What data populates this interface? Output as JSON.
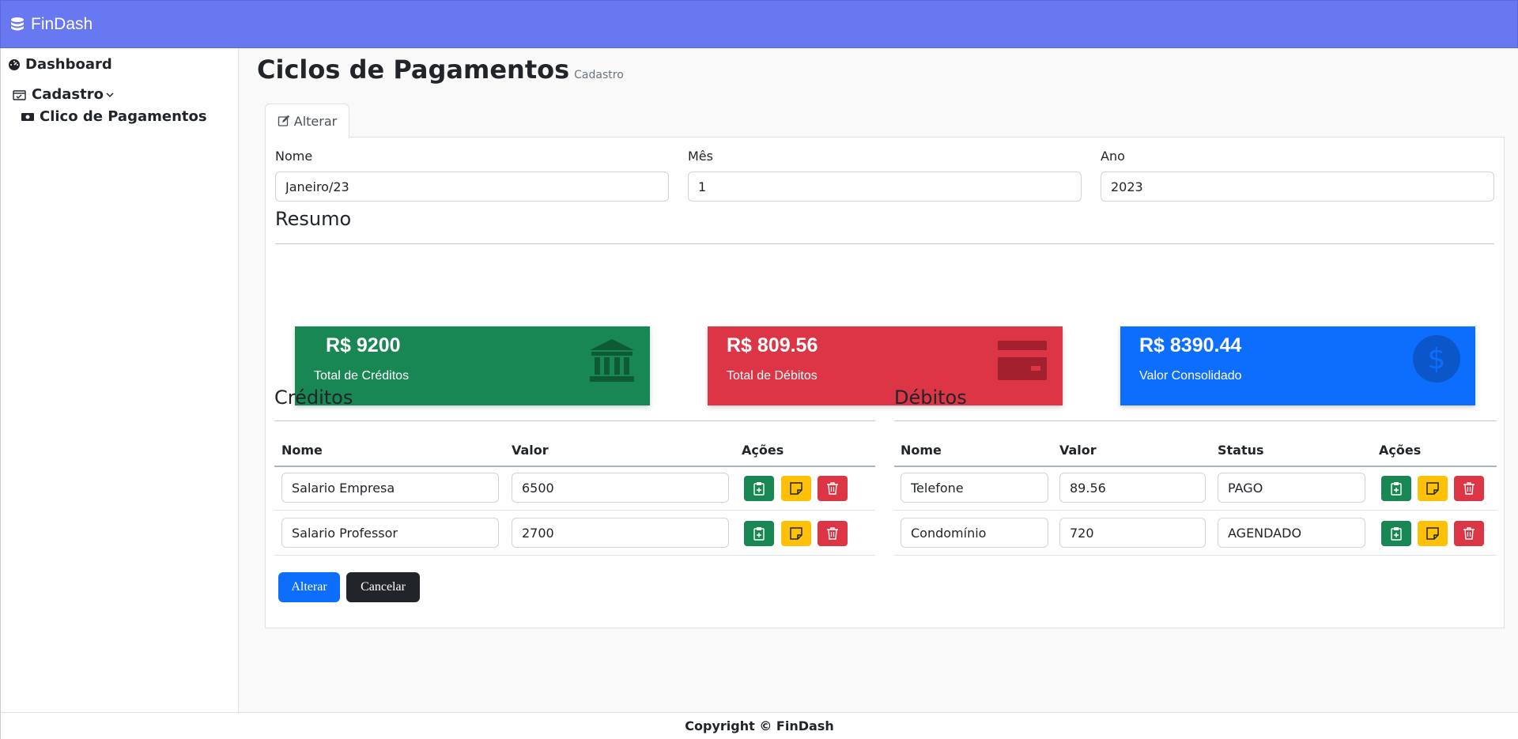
{
  "app": {
    "brand": "FinDash"
  },
  "sidebar": {
    "dashboard": "Dashboard",
    "cadastro": "Cadastro",
    "ciclo": "Clico de Pagamentos"
  },
  "page": {
    "title": "Ciclos de Pagamentos",
    "subtitle": "Cadastro"
  },
  "tab": {
    "label": "Alterar"
  },
  "form": {
    "nome_label": "Nome",
    "nome_value": "Janeiro/23",
    "mes_label": "Mês",
    "mes_value": "1",
    "ano_label": "Ano",
    "ano_value": "2023"
  },
  "resumo": {
    "title": "Resumo",
    "creditos": {
      "value": "R$ 9200",
      "label": "Total de Créditos",
      "color": "#198754"
    },
    "debitos": {
      "value": "R$ 809.56",
      "label": "Total de Débitos",
      "color": "#dc3545"
    },
    "consolidado": {
      "value": "R$ 8390.44",
      "label": "Valor Consolidado",
      "color": "#0d6efd"
    }
  },
  "creditos": {
    "title": "Créditos",
    "headers": [
      "Nome",
      "Valor",
      "Ações"
    ],
    "rows": [
      {
        "nome": "Salario Empresa",
        "valor": "6500"
      },
      {
        "nome": "Salario Professor",
        "valor": "2700"
      }
    ]
  },
  "debitos": {
    "title": "Débitos",
    "headers": [
      "Nome",
      "Valor",
      "Status",
      "Ações"
    ],
    "rows": [
      {
        "nome": "Telefone",
        "valor": "89.56",
        "status": "PAGO"
      },
      {
        "nome": "Condomínio",
        "valor": "720",
        "status": "AGENDADO"
      }
    ]
  },
  "actions": {
    "submit": "Alterar",
    "cancel": "Cancelar"
  },
  "footer": {
    "text": "Copyright © FinDash"
  }
}
